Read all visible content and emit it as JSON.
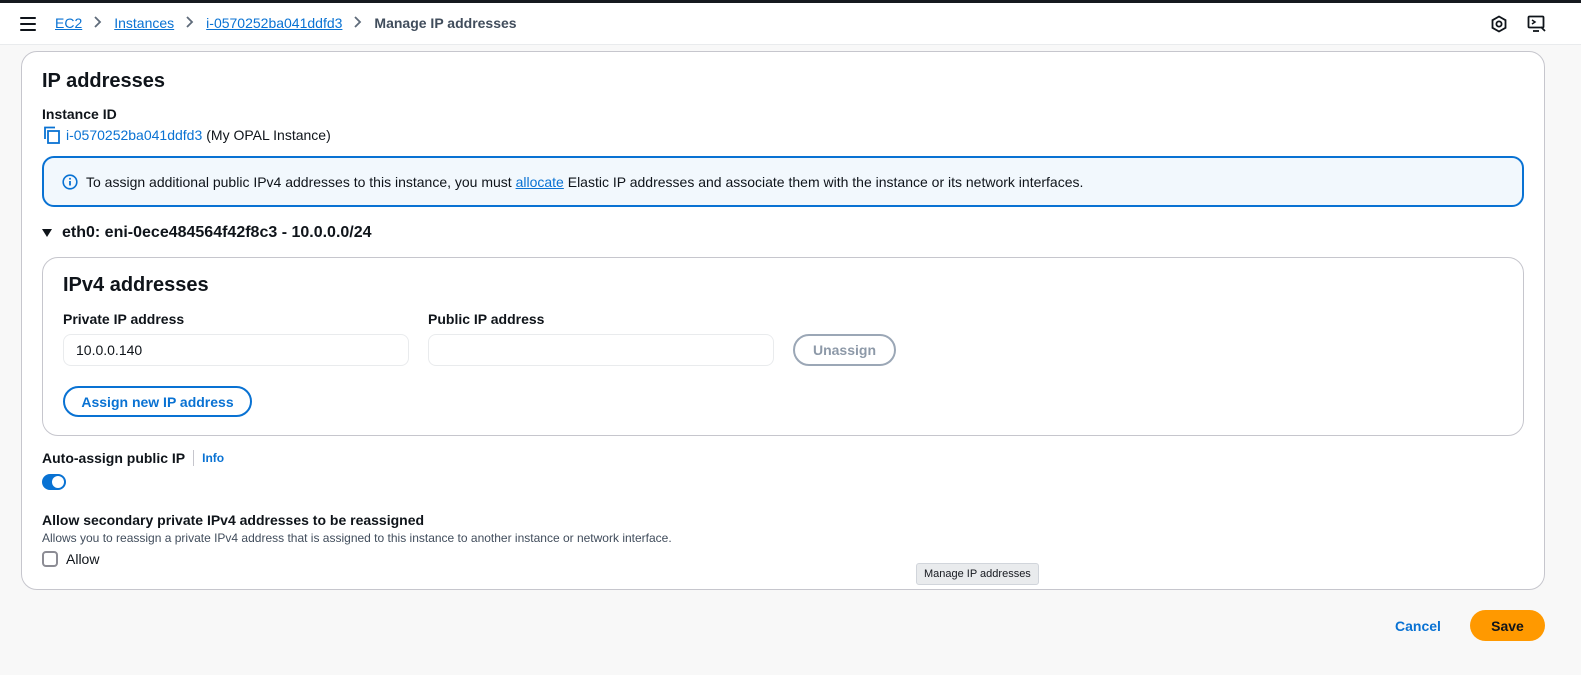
{
  "breadcrumb": {
    "items": [
      "EC2",
      "Instances",
      "i-0570252ba041ddfd3"
    ],
    "current": "Manage IP addresses"
  },
  "panel": {
    "title": "IP addresses",
    "instance_label": "Instance ID",
    "instance_id": "i-0570252ba041ddfd3",
    "instance_name": "(My OPAL Instance)"
  },
  "alert": {
    "text_before": "To assign additional public IPv4 addresses to this instance, you must",
    "link": "allocate",
    "text_after": "Elastic IP addresses and associate them with the instance or its network interfaces."
  },
  "interface": {
    "title": "eth0: eni-0ece484564f42f8c3 - 10.0.0.0/24",
    "expanded": true
  },
  "ipv4": {
    "title": "IPv4 addresses",
    "private_label": "Private IP address",
    "private_value": "10.0.0.140",
    "public_label": "Public IP address",
    "public_value": "",
    "unassign_label": "Unassign",
    "assign_label": "Assign new IP address"
  },
  "auto_assign": {
    "label": "Auto-assign public IP",
    "info": "Info",
    "enabled": true
  },
  "secondary": {
    "title": "Allow secondary private IPv4 addresses to be reassigned",
    "description": "Allows you to reassign a private IPv4 address that is assigned to this instance to another instance or network interface.",
    "checkbox_label": "Allow",
    "checked": false
  },
  "tooltip": "Manage IP addresses",
  "footer": {
    "cancel": "Cancel",
    "save": "Save"
  },
  "colors": {
    "link": "#0972d3",
    "primary_button": "#ff9900",
    "alert_bg": "#f2f8fd"
  },
  "icons": [
    "menu-icon",
    "chevron-right-icon",
    "settings-hexagon-icon",
    "display-icon",
    "copy-icon",
    "info-circle-icon",
    "caret-down-icon"
  ]
}
